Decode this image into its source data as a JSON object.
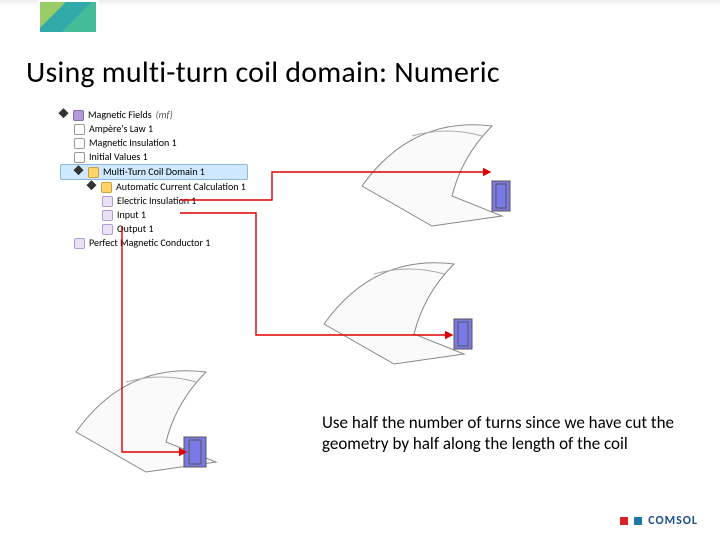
{
  "title": "Using multi-turn coil domain: Numeric",
  "tree": {
    "root": {
      "label": "Magnetic Fields",
      "suffix": "(mf)"
    },
    "items": [
      {
        "label": "Ampère's Law 1"
      },
      {
        "label": "Magnetic Insulation 1"
      },
      {
        "label": "Initial Values 1"
      }
    ],
    "coil": {
      "label": "Multi-Turn Coil Domain 1"
    },
    "coil_children": [
      {
        "label": "Automatic Current Calculation 1"
      },
      {
        "label": "Electric Insulation 1"
      },
      {
        "label": "Input 1"
      },
      {
        "label": "Output 1"
      }
    ],
    "last": {
      "label": "Perfect Magnetic Conductor 1"
    }
  },
  "caption": "Use half the number of turns since we have cut the geometry by half along the length of the coil",
  "brand": "COMSOL"
}
